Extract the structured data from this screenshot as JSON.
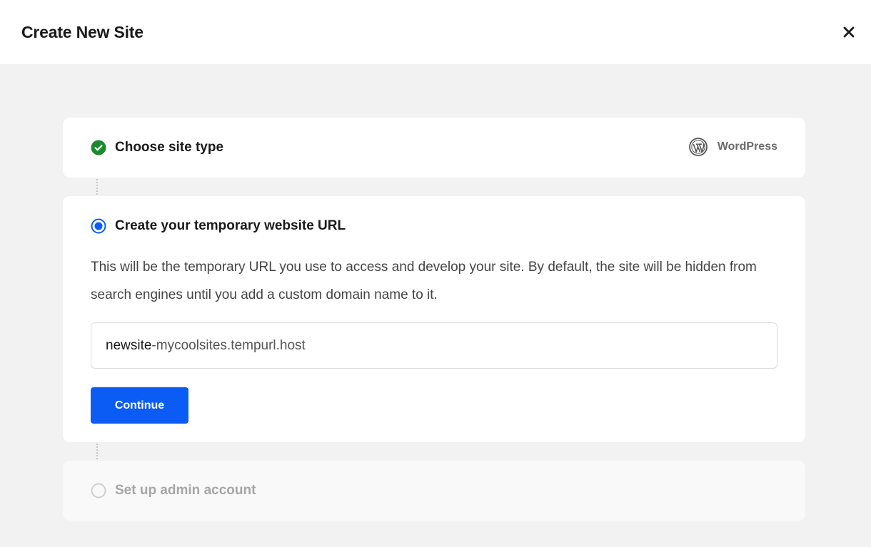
{
  "header": {
    "title": "Create New Site",
    "close_icon": "close-icon"
  },
  "steps": [
    {
      "title": "Choose site type",
      "status": "completed",
      "icon": "check-circle-icon",
      "selected_type": "WordPress",
      "selected_type_icon": "wordpress-icon"
    },
    {
      "title": "Create your temporary website URL",
      "status": "active",
      "icon": "radio-selected-icon",
      "description": "This will be the temporary URL you use to access and develop your site. By default, the site will be hidden from search engines until you add a custom domain name to it.",
      "url_subdomain": "newsite",
      "url_suffix": "-mycoolsites.tempurl.host",
      "button_label": "Continue"
    },
    {
      "title": "Set up admin account",
      "status": "pending",
      "icon": "radio-empty-icon"
    }
  ],
  "colors": {
    "accent": "#0a5cf5",
    "success": "#1a8a2e",
    "background": "#f2f2f2",
    "muted": "#a6a6a6"
  }
}
